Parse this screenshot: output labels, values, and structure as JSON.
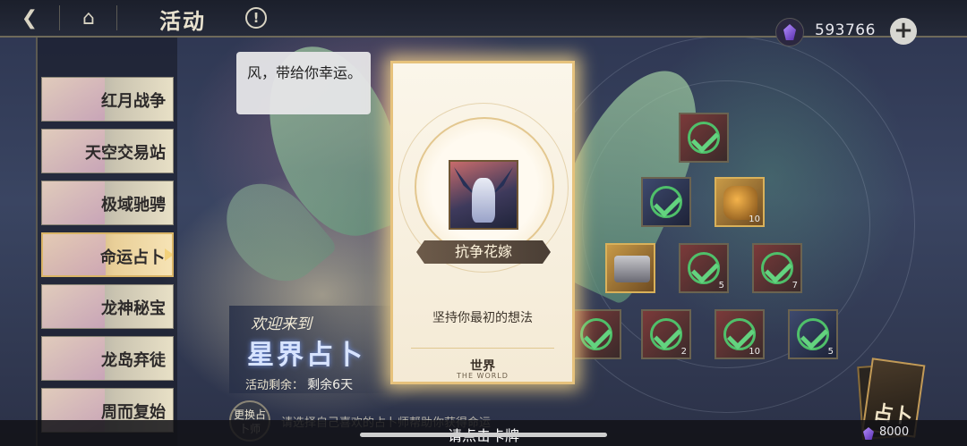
{
  "header": {
    "title": "活动",
    "back_icon": "back-arrow-icon",
    "home_icon": "home-icon",
    "info_icon": "info-icon"
  },
  "currency": {
    "value": "593766",
    "icon": "purple-gem-icon",
    "add_icon": "plus-icon"
  },
  "sidebar": {
    "items": [
      {
        "label": "红月战争"
      },
      {
        "label": "天空交易站"
      },
      {
        "label": "极域驰骋"
      },
      {
        "label": "命运占卜"
      },
      {
        "label": "龙神秘宝"
      },
      {
        "label": "龙岛弃徒"
      },
      {
        "label": "周而复始"
      }
    ],
    "active_index": 3
  },
  "bubble": {
    "text": "风，带给你幸运。"
  },
  "welcome": {
    "line1": "欢迎来到",
    "line2": "星界占卜",
    "remaining_label": "活动剩余：",
    "remaining_value": "剩余6天"
  },
  "swap_button": {
    "label": "更换占卜师"
  },
  "hint": {
    "text": "请选择自己喜欢的占卜师帮助你获得命运"
  },
  "card": {
    "name": "抗争花嫁",
    "description": "坚持你最初的想法",
    "arcana": "世界",
    "arcana_en": "THE WORLD"
  },
  "rewards": [
    {
      "qty": "",
      "kind": "red",
      "checked": true
    },
    {
      "qty": "",
      "kind": "blue",
      "checked": true
    },
    {
      "qty": "10",
      "kind": "gold",
      "checked": false
    },
    {
      "qty": "",
      "kind": "chest",
      "checked": false
    },
    {
      "qty": "5",
      "kind": "red",
      "checked": true
    },
    {
      "qty": "7",
      "kind": "red",
      "checked": true
    },
    {
      "qty": "",
      "kind": "red",
      "checked": true
    },
    {
      "qty": "2",
      "kind": "red",
      "checked": true
    },
    {
      "qty": "10",
      "kind": "red",
      "checked": true
    },
    {
      "qty": "5",
      "kind": "blue",
      "checked": true
    }
  ],
  "deck": {
    "label": "占卜",
    "cost": "8000"
  },
  "bottom": {
    "prompt": "请点击卡牌"
  }
}
